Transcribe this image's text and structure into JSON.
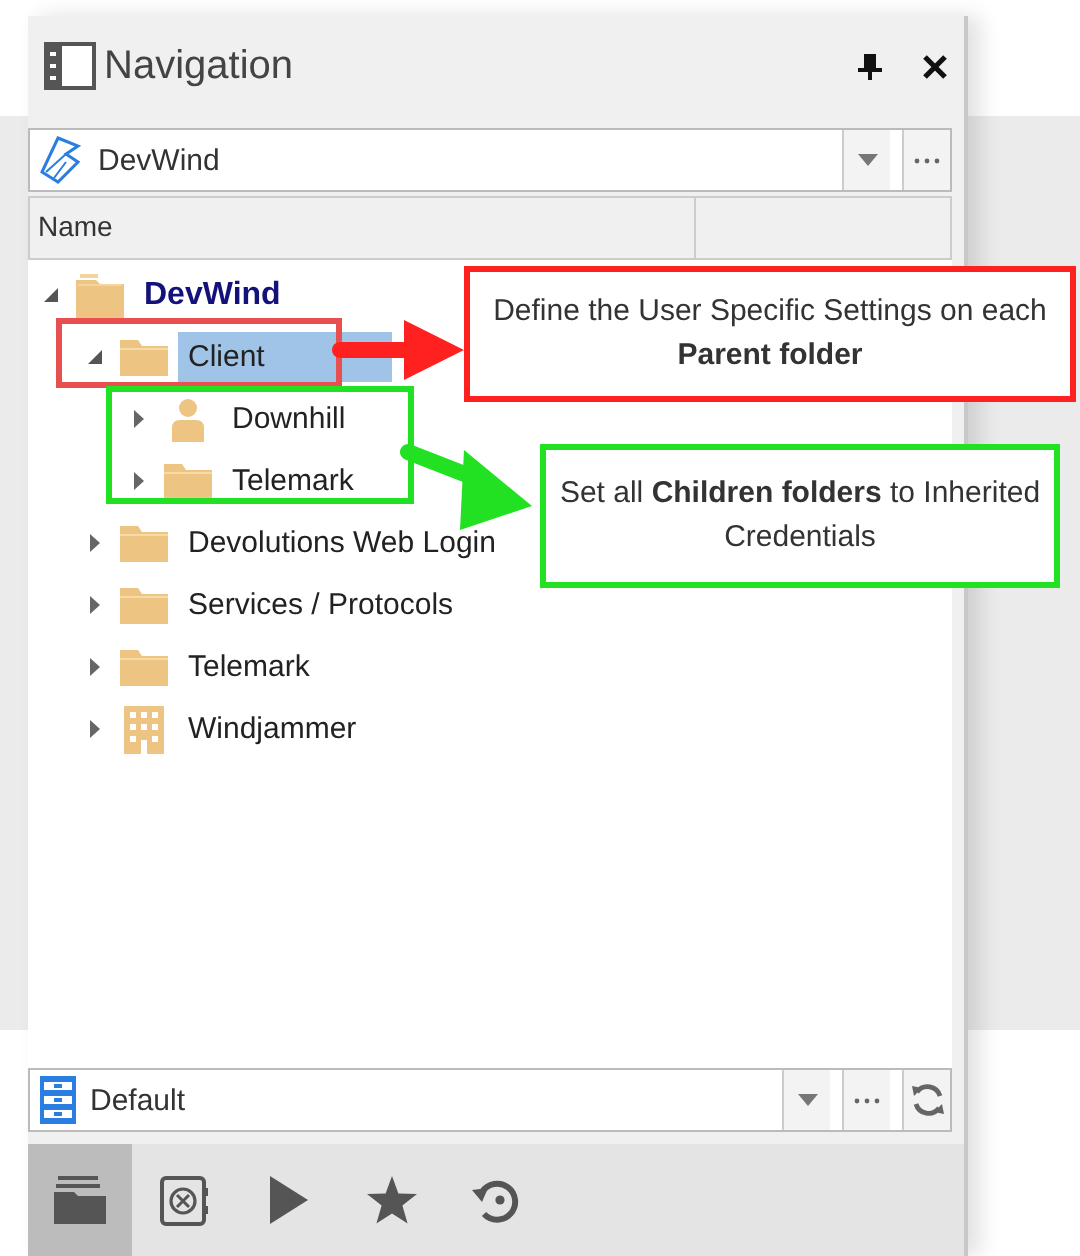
{
  "panel": {
    "title": "Navigation",
    "data_source": "DevWind",
    "column_1": "Name",
    "tree": [
      {
        "label": "DevWind",
        "kind": "vault",
        "expanded": true,
        "selected": false,
        "children": [
          {
            "label": "Client",
            "kind": "folder",
            "expanded": true,
            "selected": true,
            "children": [
              {
                "label": "Downhill",
                "kind": "user",
                "expanded": false,
                "selected": false
              },
              {
                "label": "Telemark",
                "kind": "folder",
                "expanded": false,
                "selected": false
              }
            ]
          },
          {
            "label": "Devolutions Web Login",
            "kind": "folder",
            "expanded": false,
            "selected": false
          },
          {
            "label": "Services / Protocols",
            "kind": "folder",
            "expanded": false,
            "selected": false
          },
          {
            "label": "Telemark",
            "kind": "folder",
            "expanded": false,
            "selected": false
          },
          {
            "label": "Windjammer",
            "kind": "building",
            "expanded": false,
            "selected": false
          }
        ]
      }
    ],
    "vault": "Default",
    "toolbar": [
      {
        "kind": "folders",
        "selected": true
      },
      {
        "kind": "vault",
        "selected": false
      },
      {
        "kind": "play",
        "selected": false
      },
      {
        "kind": "star",
        "selected": false
      },
      {
        "kind": "history",
        "selected": false
      }
    ]
  },
  "callouts": [
    {
      "kind": "red",
      "text": "Define the User Specific Settings on each **Parent folder**"
    },
    {
      "kind": "green",
      "text": "Set all **Children folders** to Inherited Credentials"
    }
  ]
}
